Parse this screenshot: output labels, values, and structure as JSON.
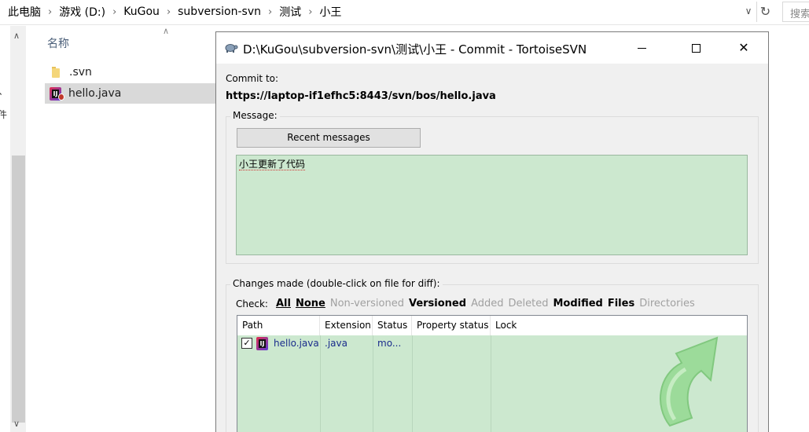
{
  "explorer": {
    "breadcrumbs": [
      "此电脑",
      "游戏 (D:)",
      "KuGou",
      "subversion-svn",
      "测试",
      "小王"
    ],
    "search_placeholder": "搜索",
    "column_name": "名称",
    "files": [
      {
        "name": ".svn",
        "icon": "folder-icon",
        "selected": false
      },
      {
        "name": "hello.java",
        "icon": "intellij-java-icon",
        "selected": true
      }
    ],
    "nav_fragment_1": "、",
    "nav_fragment_2": "件"
  },
  "dialog": {
    "title": "D:\\KuGou\\subversion-svn\\测试\\小王 - Commit - TortoiseSVN",
    "commit_to_label": "Commit to:",
    "commit_url": "https://laptop-if1efhc5:8443/svn/bos/hello.java",
    "message_label": "Message:",
    "recent_messages_label": "Recent messages",
    "message_text": "小王更新了代码",
    "changes_label": "Changes made (double-click on file for diff):",
    "check_label": "Check:",
    "check_filters": [
      {
        "label": "All",
        "active": true
      },
      {
        "label": "None",
        "active": true
      },
      {
        "label": "Non-versioned",
        "active": false
      },
      {
        "label": "Versioned",
        "active": true
      },
      {
        "label": "Added",
        "active": false
      },
      {
        "label": "Deleted",
        "active": false
      },
      {
        "label": "Modified",
        "active": true
      },
      {
        "label": "Files",
        "active": true
      },
      {
        "label": "Directories",
        "active": false
      }
    ],
    "columns": [
      "Path",
      "Extension",
      "Status",
      "Property status",
      "Lock"
    ],
    "rows": [
      {
        "checked": true,
        "path": "hello.java",
        "extension": ".java",
        "status": "mo...",
        "property_status": "",
        "lock": ""
      }
    ],
    "colors": {
      "message_bg": "#cce8cf",
      "list_bg": "#cce8cf",
      "path_text": "#1a2c8c",
      "watermark_arrow": "#8fd88a"
    }
  }
}
